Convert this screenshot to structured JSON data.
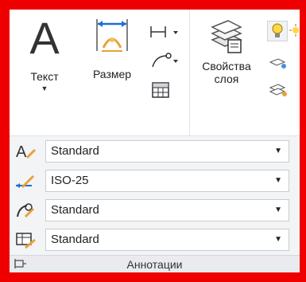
{
  "annotation_panel": {
    "text_button_label": "Текст",
    "dimension_button_label": "Размер",
    "layer_props_label_line1": "Свойства",
    "layer_props_label_line2": "слоя",
    "panel_title": "Аннотации",
    "styles": [
      {
        "name": "text-style",
        "value": "Standard"
      },
      {
        "name": "dim-style",
        "value": "ISO-25"
      },
      {
        "name": "multileader-style",
        "value": "Standard"
      },
      {
        "name": "table-style",
        "value": "Standard"
      }
    ]
  },
  "colors": {
    "frame": "#ee0000",
    "dimension_blue": "#1f6fd1",
    "accent_orange": "#e8a23a"
  }
}
